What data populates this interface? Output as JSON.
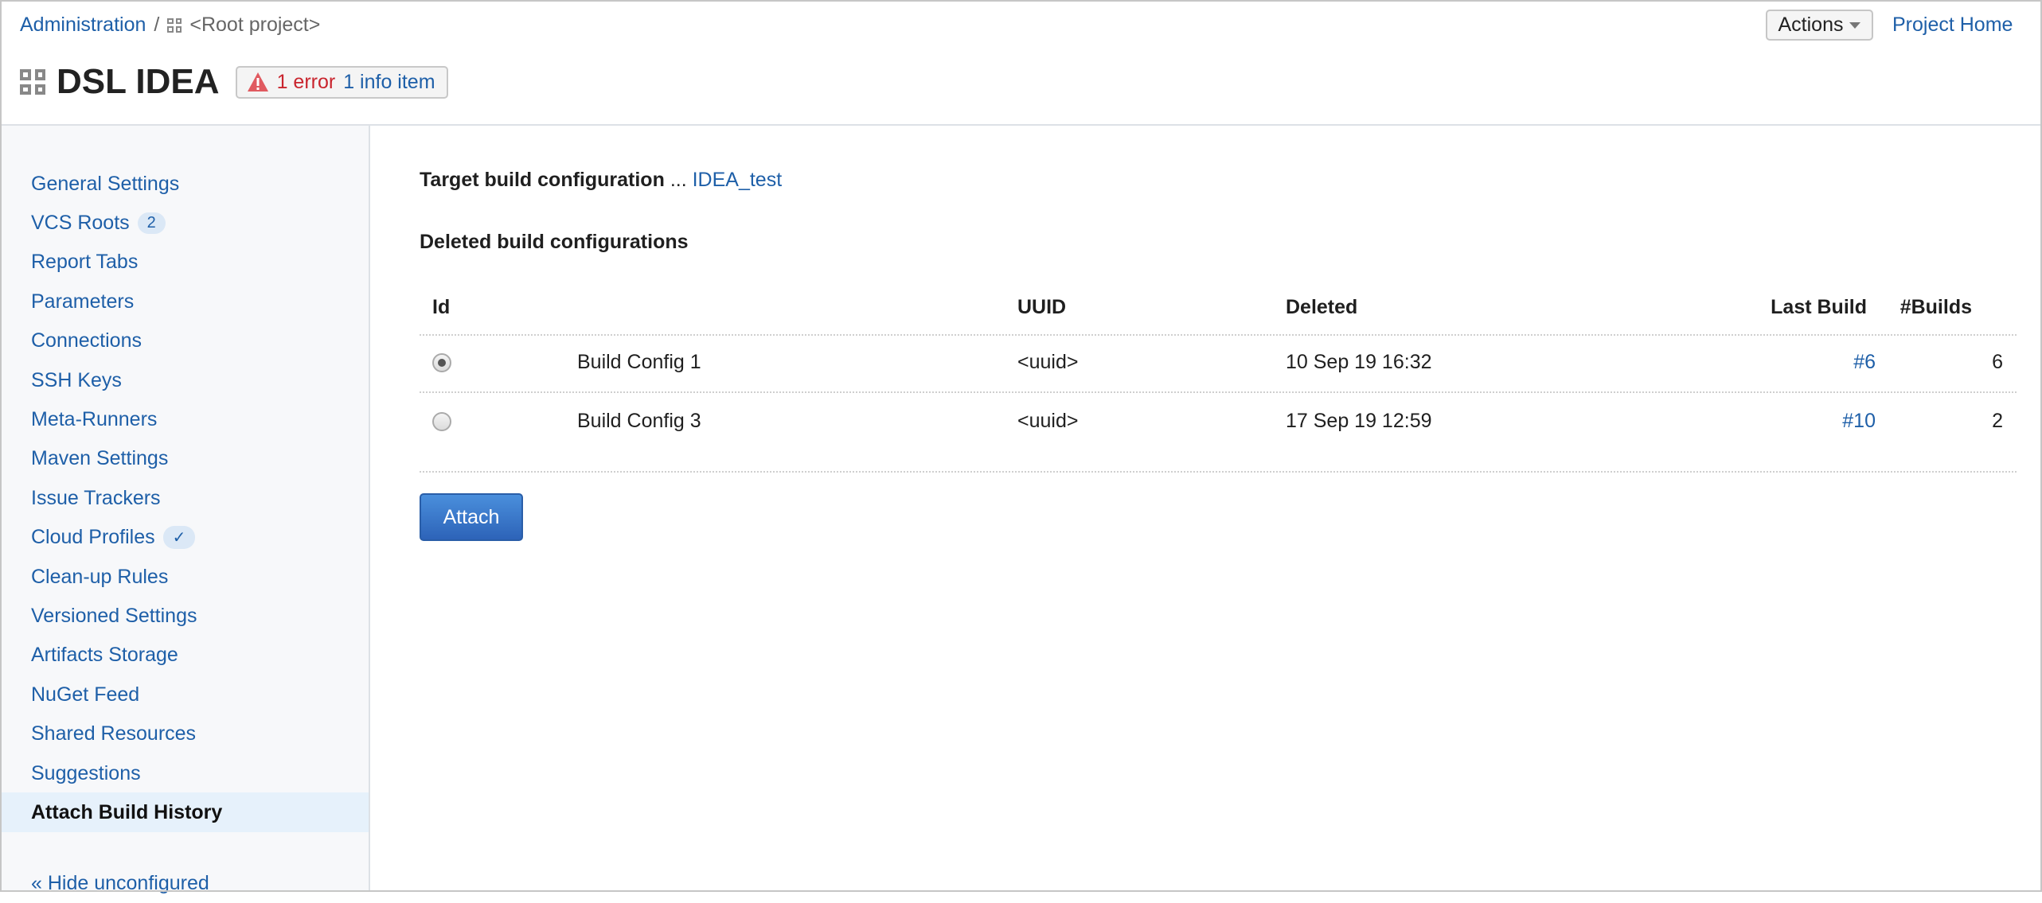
{
  "breadcrumb": {
    "admin": "Administration",
    "sep": "/",
    "root": "<Root project>"
  },
  "header": {
    "title": "DSL IDEA",
    "errors": "1 error",
    "info": "1 info item",
    "actions": "Actions",
    "project_home": "Project Home"
  },
  "sidebar": {
    "items": [
      {
        "label": "General Settings"
      },
      {
        "label": "VCS Roots",
        "badge": "2"
      },
      {
        "label": "Report Tabs"
      },
      {
        "label": "Parameters"
      },
      {
        "label": "Connections"
      },
      {
        "label": "SSH Keys"
      },
      {
        "label": "Meta-Runners"
      },
      {
        "label": "Maven Settings"
      },
      {
        "label": "Issue Trackers"
      },
      {
        "label": "Cloud Profiles",
        "badge": "✓"
      },
      {
        "label": "Clean-up Rules"
      },
      {
        "label": "Versioned Settings"
      },
      {
        "label": "Artifacts Storage"
      },
      {
        "label": "NuGet Feed"
      },
      {
        "label": "Shared Resources"
      },
      {
        "label": "Suggestions"
      },
      {
        "label": "Attach Build History"
      }
    ],
    "hide": "« Hide unconfigured"
  },
  "main": {
    "target_label": "Target build configuration",
    "target_sep": "...",
    "target_value": "IDEA_test",
    "deleted_heading": "Deleted build configurations",
    "columns": {
      "id": "Id",
      "uuid": "UUID",
      "deleted": "Deleted",
      "last_build": "Last Build",
      "builds": "#Builds"
    },
    "rows": [
      {
        "name": "Build Config 1",
        "uuid": "<uuid>",
        "deleted": "10 Sep 19 16:32",
        "last_build": "#6",
        "builds": "6",
        "selected": true
      },
      {
        "name": "Build Config 3",
        "uuid": "<uuid>",
        "deleted": "17 Sep 19 12:59",
        "last_build": "#10",
        "builds": "2",
        "selected": false
      }
    ],
    "attach": "Attach"
  }
}
